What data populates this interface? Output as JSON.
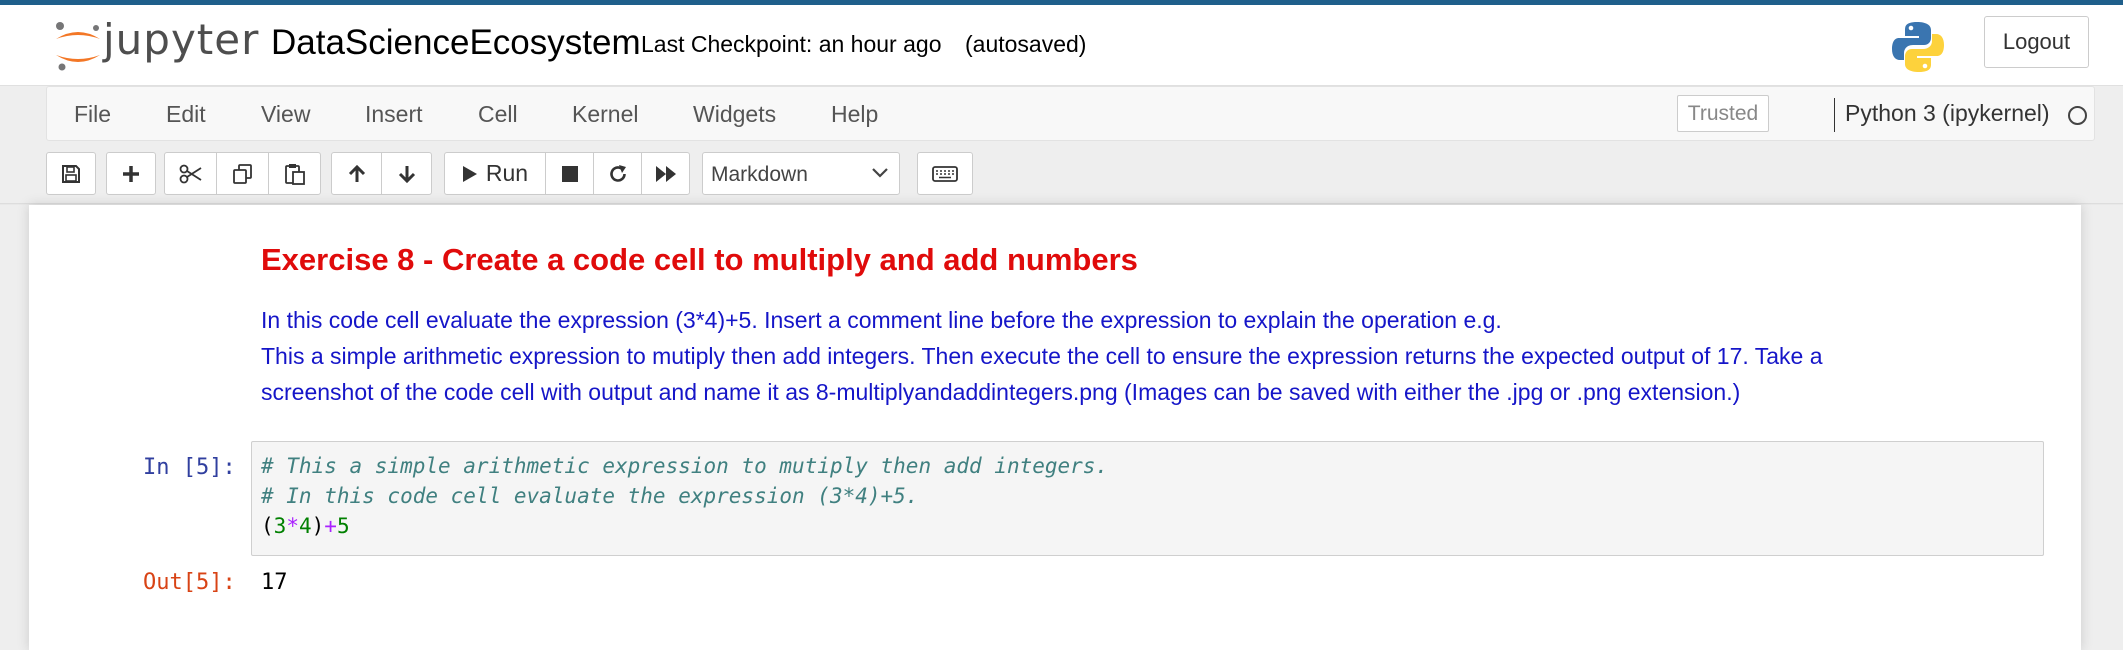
{
  "header": {
    "logo_text": "jupyter",
    "notebook_title": "DataScienceEcosystem",
    "checkpoint": "Last Checkpoint: an hour ago",
    "autosave_status": "(autosaved)",
    "logout_label": "Logout"
  },
  "menubar": {
    "items": [
      "File",
      "Edit",
      "View",
      "Insert",
      "Cell",
      "Kernel",
      "Widgets",
      "Help"
    ],
    "trusted_label": "Trusted",
    "kernel_name": "Python 3 (ipykernel)"
  },
  "toolbar": {
    "buttons": [
      "save-icon",
      "plus-icon",
      "scissors-icon",
      "copy-icon",
      "paste-icon",
      "arrow-up-icon",
      "arrow-down-icon",
      "run-icon",
      "stop-icon",
      "restart-icon",
      "fast-forward-icon",
      "keyboard-icon"
    ],
    "run_label": "Run",
    "cell_type": "Markdown"
  },
  "notebook": {
    "markdown_cell": {
      "heading": "Exercise 8 - Create a code cell to multiply and add numbers",
      "paragraph_lines": [
        "In this code cell evaluate the expression (3*4)+5. Insert a comment line before the expression to explain the operation e.g.",
        "This a simple arithmetic expression to mutiply then add integers. Then execute the cell to ensure the expression returns the expected output of 17. Take a",
        "screenshot of the code cell with output and name it as 8-multiplyandaddintegers.png (Images can be saved with either the .jpg or .png extension.)"
      ]
    },
    "code_cell": {
      "in_prompt": "In [5]:",
      "lines": {
        "comment1": "# This a simple arithmetic expression to mutiply then add integers.",
        "comment2": "# In this code cell evaluate the expression (3*4)+5.",
        "expr_open": "(",
        "expr_3": "3",
        "expr_mul": "*",
        "expr_4": "4",
        "expr_close": ")",
        "expr_plus": "+",
        "expr_5": "5"
      },
      "out_prompt": "Out[5]:",
      "output": "17"
    }
  },
  "colors": {
    "heading": "#e00b0b",
    "paragraph": "#1515c8",
    "in_prompt": "#303f9f",
    "out_prompt": "#d84315",
    "comment": "#408080"
  }
}
